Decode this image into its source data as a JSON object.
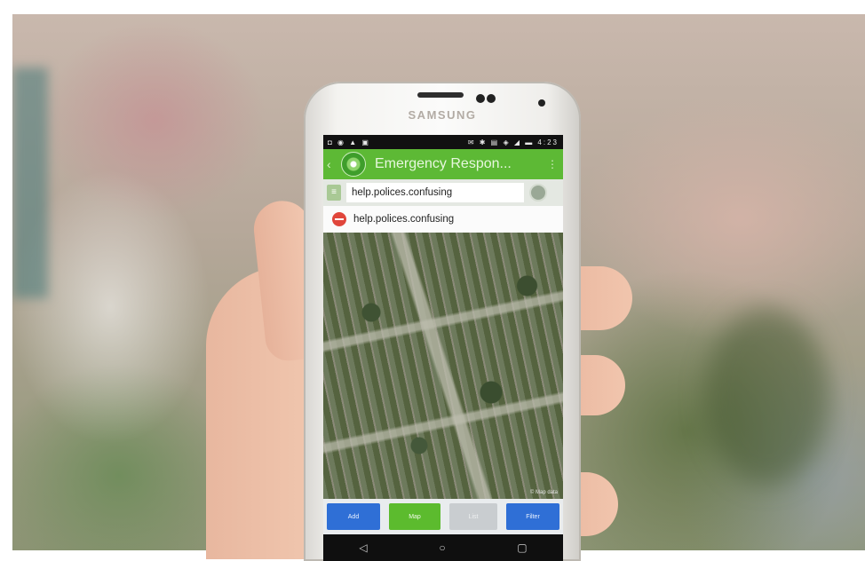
{
  "phone": {
    "brand": "SAMSUNG"
  },
  "status": {
    "icons_left": "◘ ◉ ▲ ▣",
    "icons_right": "✉ ✱ ▤ ◈ ◢ ▬ 4:23"
  },
  "appbar": {
    "title": "Emergency Respon...",
    "back_glyph": "‹",
    "overflow_glyph": "⋮"
  },
  "search": {
    "value": "help.polices.confusing",
    "lead_glyph": "≡"
  },
  "result": {
    "text": "help.polices.confusing"
  },
  "map": {
    "credit": "© Map data"
  },
  "bottom_buttons": {
    "b1": "Add",
    "b2": "Map",
    "b3": "List",
    "b4": "Filter"
  },
  "nav": {
    "back": "◁",
    "home": "○",
    "recent": "▢"
  },
  "colors": {
    "appbar": "#5db935",
    "button_blue": "#2f6fd6",
    "button_green": "#5cbb2e",
    "no_entry": "#e0463b"
  }
}
